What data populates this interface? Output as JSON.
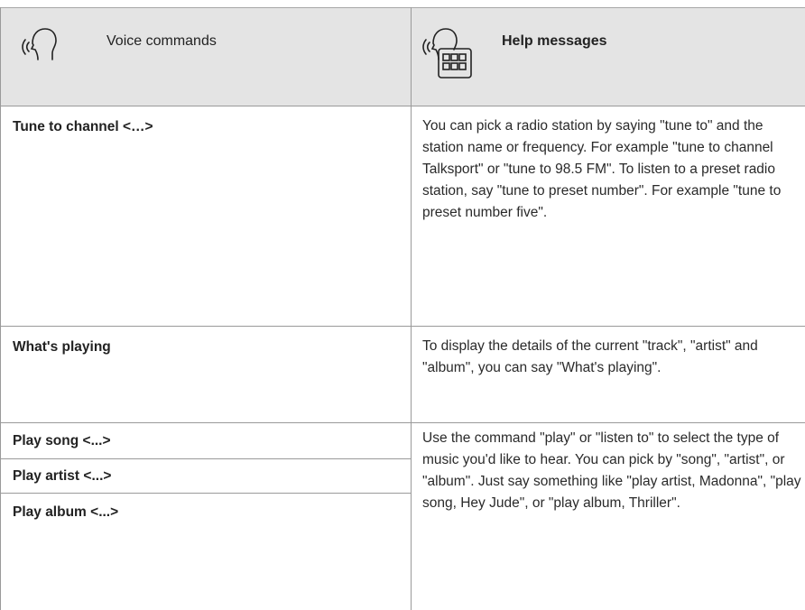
{
  "header": {
    "left_label": "Voice commands",
    "right_label": "Help messages",
    "left_icon": "voice-head-icon",
    "right_icon": "voice-keypad-icon"
  },
  "rows": [
    {
      "commands": [
        "Tune to channel <…>"
      ],
      "help": "You can pick a radio station by saying \"tune to\" and the station name or frequency. For example \"tune to channel Talksport\" or \"tune to 98.5 FM\". To listen to a preset radio station, say \"tune to preset number\". For example \"tune to preset number five\"."
    },
    {
      "commands": [
        "What's playing"
      ],
      "help": "To display the details of the current \"track\", \"artist\" and \"album\", you can say \"What's playing\"."
    },
    {
      "commands": [
        "Play song <...>",
        "Play artist <...>",
        "Play album <...>"
      ],
      "help": "Use the command \"play\" or \"listen to\" to select the type of music you'd like to hear. You can pick by \"song\", \"artist\", or \"album\". Just say something like \"play artist, Madonna\", \"play song, Hey Jude\", or \"play album, Thriller\"."
    }
  ],
  "colors": {
    "header_bg": "#e4e4e4",
    "rule": "#9a9a9a",
    "text": "#222222"
  }
}
